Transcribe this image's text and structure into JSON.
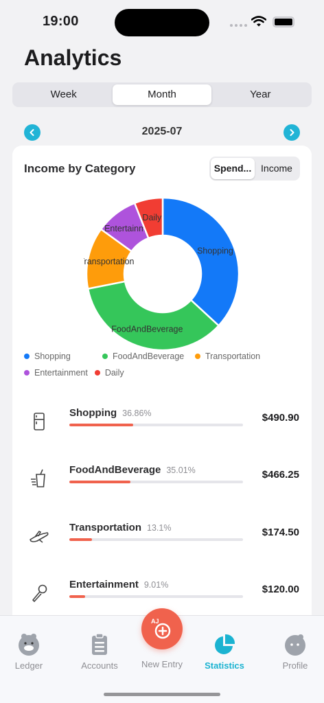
{
  "status_bar": {
    "time": "19:00"
  },
  "page": {
    "title": "Analytics"
  },
  "period_tabs": [
    {
      "label": "Week",
      "active": false
    },
    {
      "label": "Month",
      "active": true
    },
    {
      "label": "Year",
      "active": false
    }
  ],
  "date_nav": {
    "label": "2025-07"
  },
  "card": {
    "title": "Income by Category",
    "toggle": [
      {
        "label": "Spend...",
        "active": true
      },
      {
        "label": "Income",
        "active": false
      }
    ]
  },
  "chart_data": {
    "type": "pie",
    "donut": true,
    "categories": [
      "Shopping",
      "FoodAndBeverage",
      "Transportation",
      "Entertainment",
      "Daily"
    ],
    "values": [
      490.9,
      466.25,
      174.5,
      120.0,
      80.0
    ],
    "slice_labels": [
      "Shopping",
      "FoodAndBeverage",
      "Transportation",
      "Entertainme",
      "Daily"
    ],
    "colors": [
      "#1379f8",
      "#35c65a",
      "#fe9c0b",
      "#ae53dc",
      "#f13d33"
    ],
    "legend": [
      "Shopping",
      "FoodAndBeverage",
      "Transportation",
      "Entertainment",
      "Daily"
    ],
    "legend_placement": "bottom"
  },
  "categories": [
    {
      "name": "Shopping",
      "percent": "36.86%",
      "fraction": 0.3686,
      "amount": "$490.90",
      "icon": "fridge-icon"
    },
    {
      "name": "FoodAndBeverage",
      "percent": "35.01%",
      "fraction": 0.3501,
      "amount": "$466.25",
      "icon": "drink-icon"
    },
    {
      "name": "Transportation",
      "percent": "13.1%",
      "fraction": 0.131,
      "amount": "$174.50",
      "icon": "plane-icon"
    },
    {
      "name": "Entertainment",
      "percent": "9.01%",
      "fraction": 0.0901,
      "amount": "$120.00",
      "icon": "microphone-icon"
    }
  ],
  "tabbar": {
    "ledger": "Ledger",
    "accounts": "Accounts",
    "new_entry": "New Entry",
    "statistics": "Statistics",
    "profile": "Profile",
    "fab_badge": "AJ"
  },
  "colors": {
    "accent": "#1bb3d1",
    "bar": "#f0624d"
  }
}
